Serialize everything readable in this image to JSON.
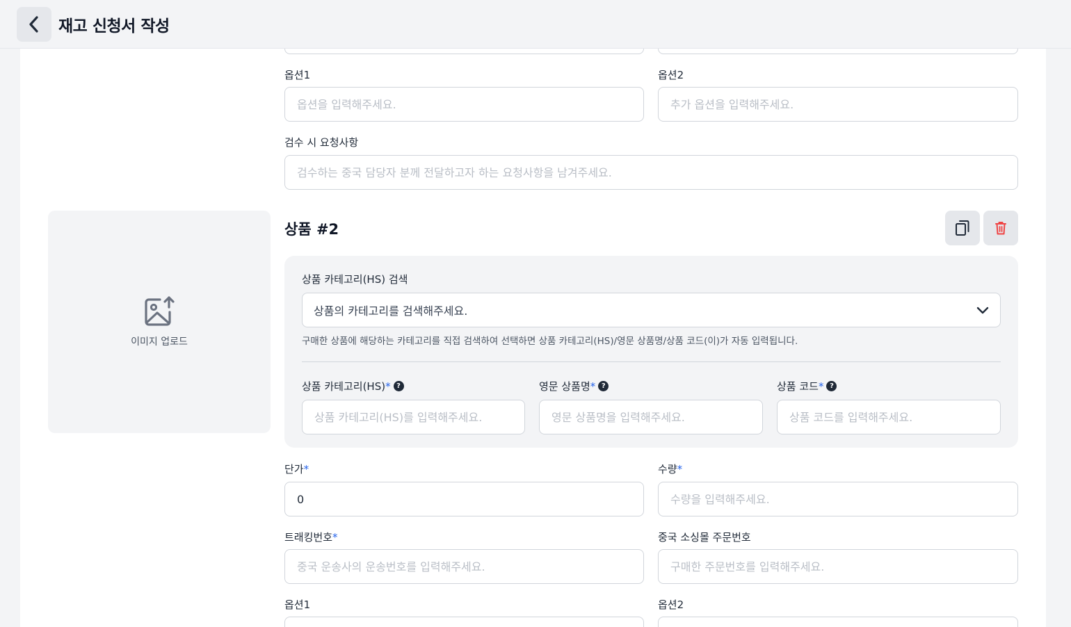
{
  "header": {
    "title": "재고 신청서 작성"
  },
  "section_top": {
    "option1_label": "옵션1",
    "option1_placeholder": "옵션을 입력해주세요.",
    "option2_label": "옵션2",
    "option2_placeholder": "추가 옵션을 입력해주세요.",
    "request_label": "검수 시 요청사항",
    "request_placeholder": "검수하는 중국 담당자 분께 전달하고자 하는 요청사항을 남겨주세요."
  },
  "image_upload": {
    "label": "이미지 업로드"
  },
  "product": {
    "title": "상품 #2",
    "hs_search_label": "상품 카테고리(HS) 검색",
    "hs_search_placeholder": "상품의 카테고리를 검색해주세요.",
    "hs_hint": "구매한 상품에 해당하는 카테고리를 직접 검색하여 선택하면 상품 카테고리(HS)/영문 상품명/상품 코드(이)가 자동 입력됩니다.",
    "hs_category_label": "상품 카테고리(HS)",
    "hs_category_placeholder": "상품 카테고리(HS)를 입력해주세요.",
    "english_name_label": "영문 상품명",
    "english_name_placeholder": "영문 상품명을 입력해주세요.",
    "product_code_label": "상품 코드",
    "product_code_placeholder": "상품 코드를 입력해주세요.",
    "unit_price_label": "단가",
    "unit_price_value": "0",
    "quantity_label": "수량",
    "quantity_placeholder": "수량을 입력해주세요.",
    "tracking_label": "트래킹번호",
    "tracking_placeholder": "중국 운송사의 운송번호를 입력해주세요.",
    "order_number_label": "중국 소싱몰 주문번호",
    "order_number_placeholder": "구매한 주문번호를 입력해주세요.",
    "option1_label": "옵션1",
    "option2_label": "옵션2"
  },
  "required_mark": "*",
  "help_mark": "?",
  "colors": {
    "accent": "#2563eb",
    "danger": "#ef4444"
  }
}
